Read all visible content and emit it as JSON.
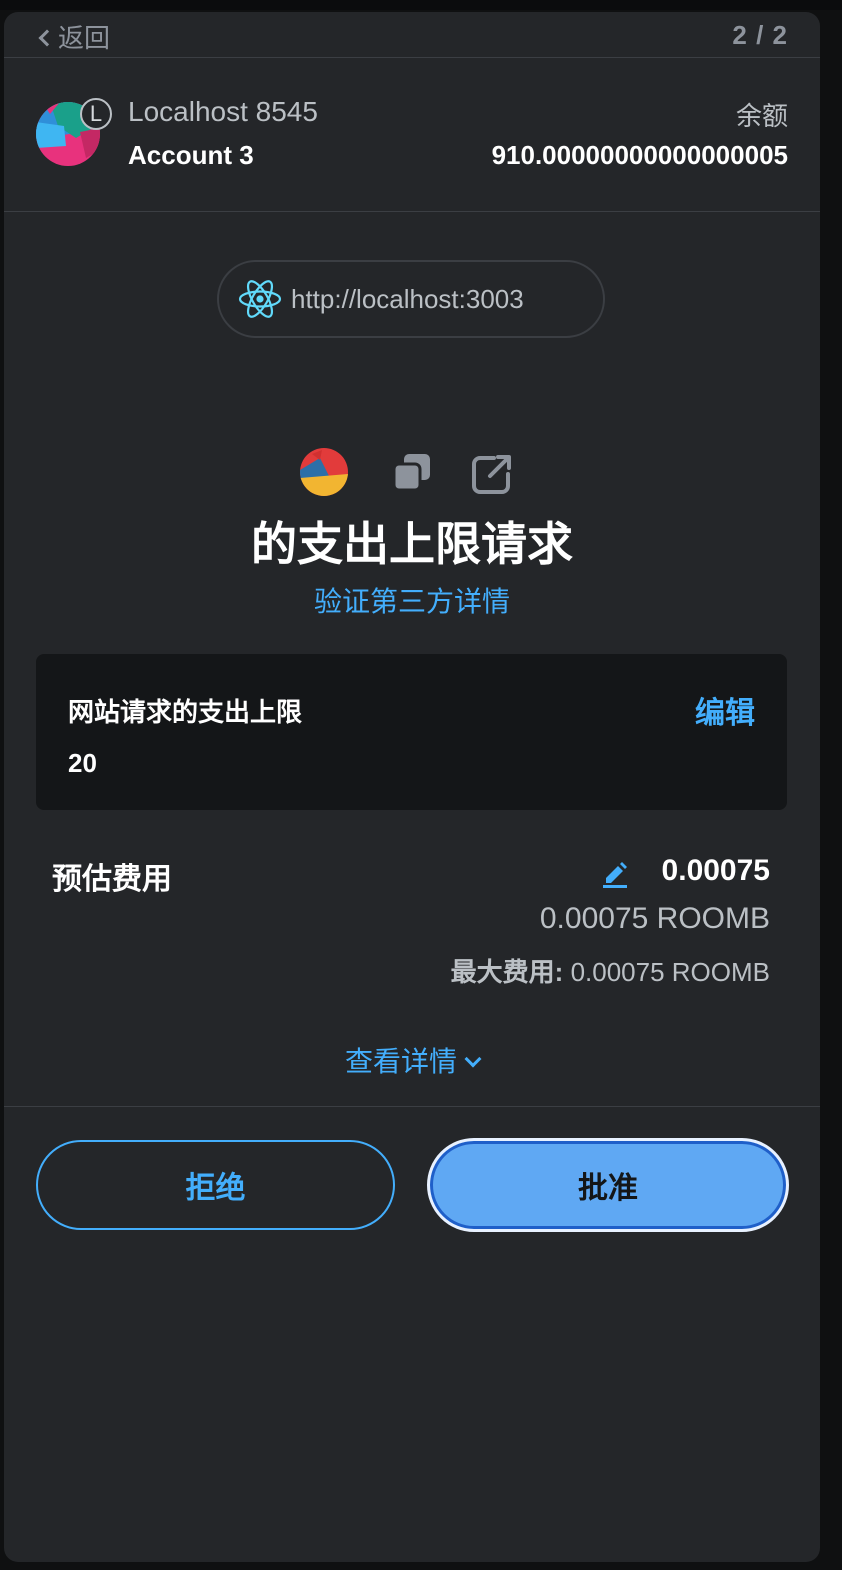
{
  "nav": {
    "back_label": "返回",
    "pager": "2 / 2"
  },
  "account": {
    "network_name": "Localhost 8545",
    "network_initial": "L",
    "account_name": "Account 3",
    "balance_label": "余额",
    "balance_value": "910.00000000000000005"
  },
  "origin": {
    "url": "http://localhost:3003",
    "icon": "react-atom-icon"
  },
  "header": {
    "icons": [
      "token-icon",
      "copy-icon",
      "external-link-icon"
    ],
    "title": "的支出上限请求",
    "verify_link": "验证第三方详情"
  },
  "spending_limit": {
    "label": "网站请求的支出上限",
    "edit_label": "编辑",
    "value": "20"
  },
  "fee": {
    "label": "预估费用",
    "value": "0.00075",
    "fiat": "0.00075 ROOMB",
    "max_label": "最大费用:",
    "max_value": "0.00075 ROOMB"
  },
  "details_link": "查看详情",
  "footer": {
    "reject_label": "拒绝",
    "approve_label": "批准"
  },
  "colors": {
    "accent": "#43aefc",
    "approve_bg": "#5fa8f3",
    "panel_bg": "#242629",
    "box_bg": "#141618"
  }
}
